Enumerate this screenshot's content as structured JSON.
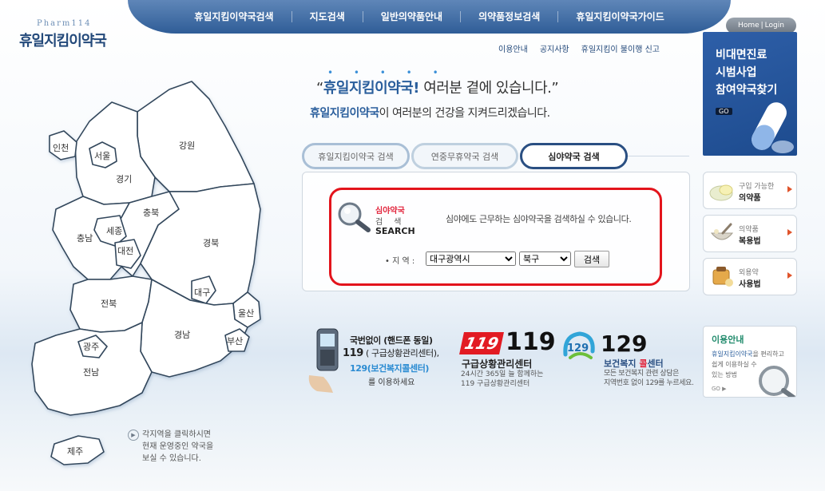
{
  "logo": {
    "sub": "Pharm114",
    "main": "휴일지킴이약국"
  },
  "topnav": {
    "items": [
      "휴일지킴이약국검색",
      "지도검색",
      "일반의약품안내",
      "의약품정보검색",
      "휴일지킴이약국가이드"
    ]
  },
  "account": {
    "home": "Home",
    "sep": "|",
    "login": "Login"
  },
  "subnav": {
    "items": [
      "이용안내",
      "공지사항",
      "휴일지킴이 불이행 신고"
    ]
  },
  "slogan": {
    "dots": "• • • • •",
    "open_quote": "“",
    "brand": "휴일지킴이약국",
    "excl": "!",
    "rest": " 여러분 곁에 있습니다.”",
    "line2_brand": "휴일지킴이약국",
    "line2_rest": "이 여러분의 건강을 지켜드리겠습니다."
  },
  "map": {
    "regions": {
      "incheon": "인천",
      "seoul": "서울",
      "gyeonggi": "경기",
      "gangwon": "강원",
      "chungbuk": "충북",
      "chungnam": "충남",
      "sejong": "세종",
      "daejeon": "대전",
      "gyeongbuk": "경북",
      "daegu": "대구",
      "jeonbuk": "전북",
      "ulsan": "울산",
      "gyeongnam": "경남",
      "busan": "부산",
      "gwangju": "광주",
      "jeonnam": "전남",
      "jeju": "제주"
    },
    "hint": [
      "각지역을 클릭하시면",
      "현재 운영중인 약국을",
      "보실 수 있습니다."
    ]
  },
  "tabs": [
    "휴일지킴이약국 검색",
    "연중무휴약국 검색",
    "심야약국 검색"
  ],
  "search": {
    "title1": "심야약국",
    "title2": "검색",
    "title3": "SEARCH",
    "desc": "심야에도 근무하는 심야약국을 검색하실 수 있습니다.",
    "region_label": "• 지 역 :",
    "sido": "대구광역시",
    "gu": "북구",
    "button": "검색"
  },
  "banner": {
    "line1": "비대면진료",
    "line2": "시범사업",
    "line3": "참여약국찾기",
    "go": "GO"
  },
  "side_boxes": [
    {
      "line1": "구입 가능한",
      "line2": "의약품"
    },
    {
      "line1": "의약품",
      "line2": "복용법"
    },
    {
      "line1": "외용약",
      "line2": "사용법"
    }
  ],
  "hotline": {
    "line1": "국번없이 (핸드폰 동일)",
    "line2_num": "119",
    "line2_rest": " ( 구급상황관리센터),",
    "line3": "129(보건복지콜센터)",
    "line4": "를 이용하세요"
  },
  "c119": {
    "logo": "119",
    "num": "119",
    "title": "구급상황관리센터",
    "desc": [
      "24시간 365일 늘 함께하는",
      "119 구급상황관리센터"
    ]
  },
  "c129": {
    "logo": "129",
    "num": "129",
    "title_a": "보건복지 ",
    "title_b": "콜",
    "title_c": "센터",
    "desc": [
      "모든 보건복지 관련 상담은",
      "지역번호 없이 129를 누르세요."
    ]
  },
  "guide": {
    "title": "이용안내",
    "brand": "휴일지킴이약국",
    "text_rest": "을 편리하고",
    "text2": "쉽게 이용하실 수",
    "text3": "있는 방법",
    "go": "GO ▶"
  },
  "colors": {
    "nav": "#2f5d97",
    "accent_red": "#e3141c",
    "brand_blue": "#2a5e9c"
  }
}
